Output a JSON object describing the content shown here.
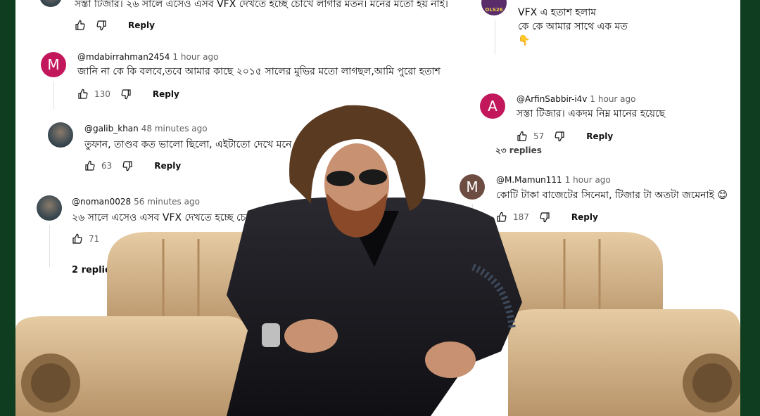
{
  "comments": {
    "top_partial": {
      "text": "সস্তা টিজার। ২৬ সালে এসেও এসব VFX দেখতে হচ্ছে চোখে লাগার মতন। মনের মতো হয় নাই।",
      "reply": "Reply"
    },
    "c1": {
      "avatar_letter": "M",
      "avatar_color": "#c2185b",
      "author": "@mdabirrahman2454",
      "time": "1 hour ago",
      "text": "জানি না কে কি বলবে,তবে আমার কাছে ২০১৫ সালের মুভির মতো লাগছল,আমি পুরো হতাশ",
      "likes": "130",
      "reply": "Reply"
    },
    "c2": {
      "author": "@galib_khan",
      "time": "48 minutes ago",
      "text": "তুফান, তাণ্ডব কত ভালো ছিলো, এইটাতো দেখে মনে",
      "trailing": "💔💔",
      "likes": "63",
      "reply": "Reply"
    },
    "c3": {
      "author": "@noman0028",
      "time": "56 minutes ago",
      "text": "২৬ সালে এসেও এসব VFX দেখতে হচ্ছে চোখে",
      "likes": "71",
      "replies_link": "2 replies"
    },
    "r0": {
      "line1": "VFX এ হতাশ হলাম",
      "line2": "কে কে আমার সাথে এক মত",
      "emoji": "👇",
      "avatar_text": "OLS26"
    },
    "r1": {
      "avatar_letter": "A",
      "avatar_color": "#c2185b",
      "author": "@ArfinSabbir-i4v",
      "time": "1 hour ago",
      "text": "সস্তা টিজার। একদম নিম্ন মানের হয়েছে",
      "likes": "57",
      "reply": "Reply",
      "replies_partial": "২৩ replies"
    },
    "r2": {
      "avatar_letter": "M",
      "avatar_color": "#6d4c41",
      "author": "@M.Mamun111",
      "time": "1 hour ago",
      "text": "কোটি টাকা বাজেটের সিনেমা, টিজার টা অতটা জমেনাই 😊",
      "likes": "187",
      "reply": "Reply"
    }
  },
  "colors": {
    "border": "#0f3d1f",
    "chair": "#d9b98e",
    "suit": "#1c1b1f"
  }
}
